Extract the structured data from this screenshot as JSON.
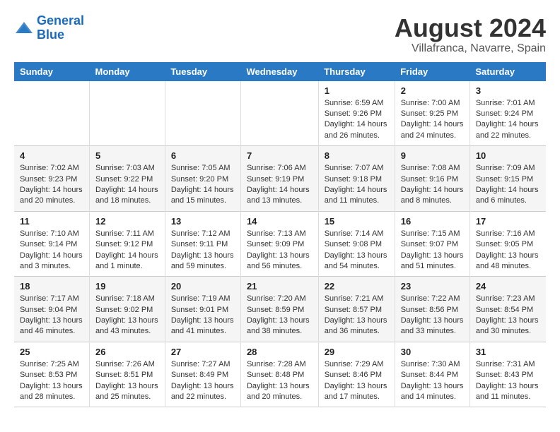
{
  "header": {
    "logo_line1": "General",
    "logo_line2": "Blue",
    "month_year": "August 2024",
    "location": "Villafranca, Navarre, Spain"
  },
  "days_of_week": [
    "Sunday",
    "Monday",
    "Tuesday",
    "Wednesday",
    "Thursday",
    "Friday",
    "Saturday"
  ],
  "weeks": [
    [
      {
        "num": "",
        "info": ""
      },
      {
        "num": "",
        "info": ""
      },
      {
        "num": "",
        "info": ""
      },
      {
        "num": "",
        "info": ""
      },
      {
        "num": "1",
        "info": "Sunrise: 6:59 AM\nSunset: 9:26 PM\nDaylight: 14 hours\nand 26 minutes."
      },
      {
        "num": "2",
        "info": "Sunrise: 7:00 AM\nSunset: 9:25 PM\nDaylight: 14 hours\nand 24 minutes."
      },
      {
        "num": "3",
        "info": "Sunrise: 7:01 AM\nSunset: 9:24 PM\nDaylight: 14 hours\nand 22 minutes."
      }
    ],
    [
      {
        "num": "4",
        "info": "Sunrise: 7:02 AM\nSunset: 9:23 PM\nDaylight: 14 hours\nand 20 minutes."
      },
      {
        "num": "5",
        "info": "Sunrise: 7:03 AM\nSunset: 9:22 PM\nDaylight: 14 hours\nand 18 minutes."
      },
      {
        "num": "6",
        "info": "Sunrise: 7:05 AM\nSunset: 9:20 PM\nDaylight: 14 hours\nand 15 minutes."
      },
      {
        "num": "7",
        "info": "Sunrise: 7:06 AM\nSunset: 9:19 PM\nDaylight: 14 hours\nand 13 minutes."
      },
      {
        "num": "8",
        "info": "Sunrise: 7:07 AM\nSunset: 9:18 PM\nDaylight: 14 hours\nand 11 minutes."
      },
      {
        "num": "9",
        "info": "Sunrise: 7:08 AM\nSunset: 9:16 PM\nDaylight: 14 hours\nand 8 minutes."
      },
      {
        "num": "10",
        "info": "Sunrise: 7:09 AM\nSunset: 9:15 PM\nDaylight: 14 hours\nand 6 minutes."
      }
    ],
    [
      {
        "num": "11",
        "info": "Sunrise: 7:10 AM\nSunset: 9:14 PM\nDaylight: 14 hours\nand 3 minutes."
      },
      {
        "num": "12",
        "info": "Sunrise: 7:11 AM\nSunset: 9:12 PM\nDaylight: 14 hours\nand 1 minute."
      },
      {
        "num": "13",
        "info": "Sunrise: 7:12 AM\nSunset: 9:11 PM\nDaylight: 13 hours\nand 59 minutes."
      },
      {
        "num": "14",
        "info": "Sunrise: 7:13 AM\nSunset: 9:09 PM\nDaylight: 13 hours\nand 56 minutes."
      },
      {
        "num": "15",
        "info": "Sunrise: 7:14 AM\nSunset: 9:08 PM\nDaylight: 13 hours\nand 54 minutes."
      },
      {
        "num": "16",
        "info": "Sunrise: 7:15 AM\nSunset: 9:07 PM\nDaylight: 13 hours\nand 51 minutes."
      },
      {
        "num": "17",
        "info": "Sunrise: 7:16 AM\nSunset: 9:05 PM\nDaylight: 13 hours\nand 48 minutes."
      }
    ],
    [
      {
        "num": "18",
        "info": "Sunrise: 7:17 AM\nSunset: 9:04 PM\nDaylight: 13 hours\nand 46 minutes."
      },
      {
        "num": "19",
        "info": "Sunrise: 7:18 AM\nSunset: 9:02 PM\nDaylight: 13 hours\nand 43 minutes."
      },
      {
        "num": "20",
        "info": "Sunrise: 7:19 AM\nSunset: 9:01 PM\nDaylight: 13 hours\nand 41 minutes."
      },
      {
        "num": "21",
        "info": "Sunrise: 7:20 AM\nSunset: 8:59 PM\nDaylight: 13 hours\nand 38 minutes."
      },
      {
        "num": "22",
        "info": "Sunrise: 7:21 AM\nSunset: 8:57 PM\nDaylight: 13 hours\nand 36 minutes."
      },
      {
        "num": "23",
        "info": "Sunrise: 7:22 AM\nSunset: 8:56 PM\nDaylight: 13 hours\nand 33 minutes."
      },
      {
        "num": "24",
        "info": "Sunrise: 7:23 AM\nSunset: 8:54 PM\nDaylight: 13 hours\nand 30 minutes."
      }
    ],
    [
      {
        "num": "25",
        "info": "Sunrise: 7:25 AM\nSunset: 8:53 PM\nDaylight: 13 hours\nand 28 minutes."
      },
      {
        "num": "26",
        "info": "Sunrise: 7:26 AM\nSunset: 8:51 PM\nDaylight: 13 hours\nand 25 minutes."
      },
      {
        "num": "27",
        "info": "Sunrise: 7:27 AM\nSunset: 8:49 PM\nDaylight: 13 hours\nand 22 minutes."
      },
      {
        "num": "28",
        "info": "Sunrise: 7:28 AM\nSunset: 8:48 PM\nDaylight: 13 hours\nand 20 minutes."
      },
      {
        "num": "29",
        "info": "Sunrise: 7:29 AM\nSunset: 8:46 PM\nDaylight: 13 hours\nand 17 minutes."
      },
      {
        "num": "30",
        "info": "Sunrise: 7:30 AM\nSunset: 8:44 PM\nDaylight: 13 hours\nand 14 minutes."
      },
      {
        "num": "31",
        "info": "Sunrise: 7:31 AM\nSunset: 8:43 PM\nDaylight: 13 hours\nand 11 minutes."
      }
    ]
  ]
}
